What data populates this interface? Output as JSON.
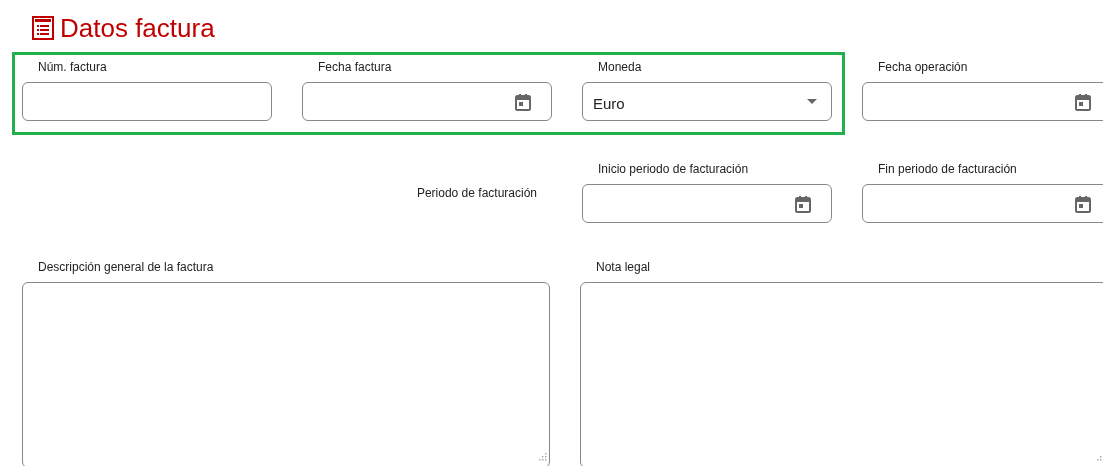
{
  "title": "Datos factura",
  "rows": [
    {
      "highlighted_fields": [
        {
          "kind": "text",
          "label": "Núm. factura"
        },
        {
          "kind": "date",
          "label": "Fecha factura"
        },
        {
          "kind": "select",
          "label": "Moneda",
          "value": "Euro"
        }
      ],
      "fields": [
        {
          "kind": "date",
          "label": "Fecha operación"
        }
      ]
    },
    {
      "side_label": "Periodo de facturación",
      "fields": [
        {
          "kind": "date",
          "label": "Inicio periodo de facturación"
        },
        {
          "kind": "date",
          "label": "Fin periodo de facturación"
        }
      ]
    },
    {
      "fields": [
        {
          "kind": "textarea",
          "label": "Descripción general de la factura"
        },
        {
          "kind": "textarea",
          "label": "Nota legal"
        }
      ]
    }
  ]
}
